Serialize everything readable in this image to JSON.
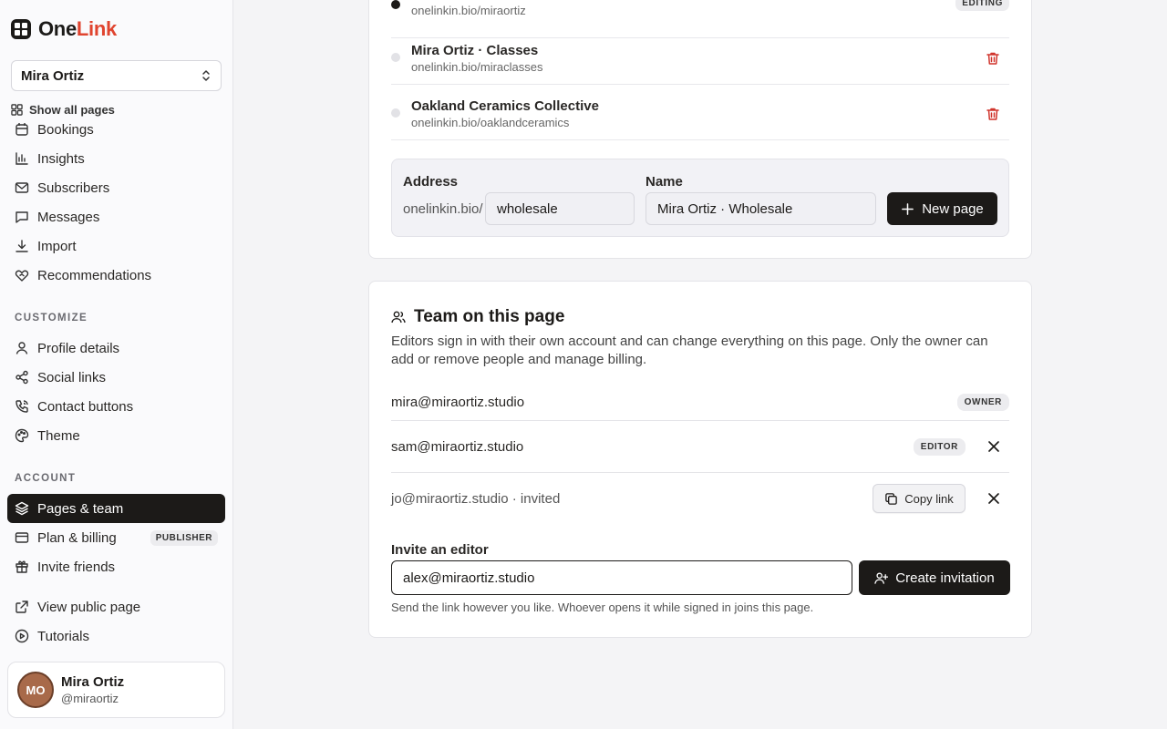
{
  "brand": {
    "part1": "One",
    "part2": "Link"
  },
  "page_selector": {
    "value": "Mira Ortiz"
  },
  "show_all_label": "Show all pages",
  "nav": {
    "partial_item": "Bookings",
    "items": [
      "Insights",
      "Subscribers",
      "Messages",
      "Import",
      "Recommendations"
    ],
    "customize_label": "CUSTOMIZE",
    "customize_items": [
      "Profile details",
      "Social links",
      "Contact buttons",
      "Theme"
    ],
    "account_label": "ACCOUNT",
    "account_items": [
      "Pages & team",
      "Plan & billing",
      "Invite friends"
    ],
    "plan_badge": "PUBLISHER",
    "extra_items": [
      "View public page",
      "Tutorials"
    ]
  },
  "user": {
    "initials": "MO",
    "name": "Mira Ortiz",
    "handle": "@miraortiz"
  },
  "pages": [
    {
      "name": "",
      "url": "onelinkin.bio/miraortiz",
      "tag": "EDITING",
      "active": true
    },
    {
      "name": "Mira Ortiz · Classes",
      "url": "onelinkin.bio/miraclasses"
    },
    {
      "name": "Oakland Ceramics Collective",
      "url": "onelinkin.bio/oaklandceramics"
    }
  ],
  "new_page": {
    "address_label": "Address",
    "prefix": "onelinkin.bio/",
    "address_value": "wholesale",
    "name_label": "Name",
    "name_value": "Mira Ortiz · Wholesale",
    "button": "New page"
  },
  "team": {
    "title": "Team on this page",
    "description": "Editors sign in with their own account and can change everything on this page. Only the owner can add or remove people and manage billing.",
    "members": [
      {
        "email": "mira@miraortiz.studio",
        "role": "OWNER"
      },
      {
        "email": "sam@miraortiz.studio",
        "role": "EDITOR"
      },
      {
        "email": "jo@miraortiz.studio · invited",
        "action": "Copy link"
      }
    ],
    "invite_label": "Invite an editor",
    "invite_value": "alex@miraortiz.studio",
    "invite_button": "Create invitation",
    "help": "Send the link however you like. Whoever opens it while signed in joins this page."
  },
  "colors": {
    "accent": "#e0442f",
    "dark": "#1c1a18",
    "danger": "#d0342c"
  }
}
